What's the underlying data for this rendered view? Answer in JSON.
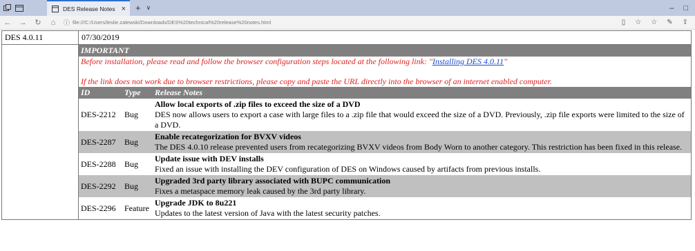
{
  "browser": {
    "tab_title": "DES Release Notes",
    "url": "file:///C:/Users/leslie.zalewski/Downloads/DES%20technical%20release%20notes.html"
  },
  "release": {
    "version": "DES 4.0.11",
    "date": "07/30/2019",
    "important_header": "IMPORTANT",
    "important_line1_prefix": "Before installation, please read and follow the browser configuration steps located at the following link: \"",
    "important_link": "Installing DES 4.0.11",
    "important_line1_suffix": "\"",
    "important_line2": "If the link does not work due to browser restrictions, please copy and paste the URL directly into the browser of an internet enabled computer.",
    "columns": {
      "id": "ID",
      "type": "Type",
      "notes": "Release Notes"
    },
    "items": [
      {
        "id": "DES-2212",
        "type": "Bug",
        "title": "Allow local exports of .zip files to exceed the size of a DVD",
        "desc": "DES now allows users to export a case with large files to a .zip file that would exceed the size of a DVD. Previously, .zip file exports were limited to the size of a DVD."
      },
      {
        "id": "DES-2287",
        "type": "Bug",
        "title": "Enable recategorization for BVXV videos",
        "desc": "The DES 4.0.10 release prevented users from recategorizing BVXV videos from Body Worn to another category. This restriction has been fixed in this release."
      },
      {
        "id": "DES-2288",
        "type": "Bug",
        "title": "Update issue with DEV installs",
        "desc": "Fixed an issue with installing the DEV configuration of DES on Windows caused by artifacts from previous installs."
      },
      {
        "id": "DES-2292",
        "type": "Bug",
        "title": "Upgraded 3rd party library associated with BUPC communication",
        "desc": "Fixes a metaspace memory leak caused by the 3rd party library."
      },
      {
        "id": "DES-2296",
        "type": "Feature",
        "title": "Upgrade JDK to 8u221",
        "desc": "Updates to the latest version of Java with the latest security patches."
      }
    ]
  }
}
